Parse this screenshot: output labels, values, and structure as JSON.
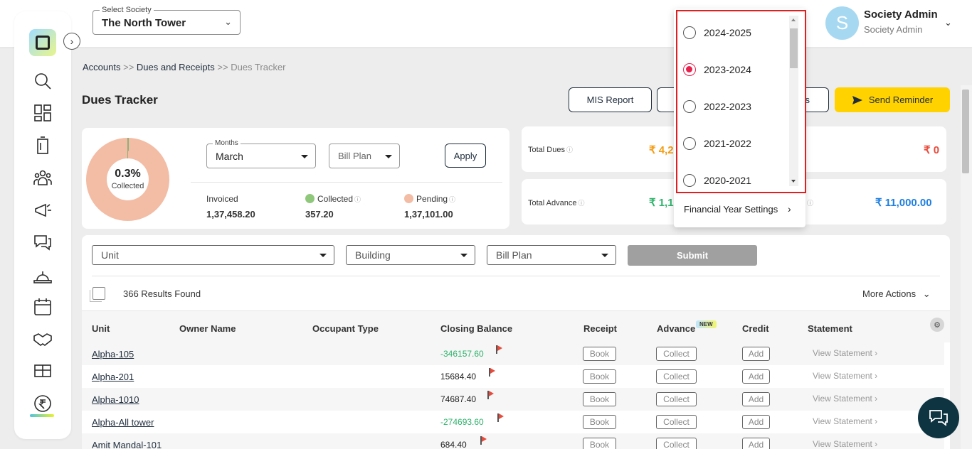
{
  "header": {
    "society_label": "Select Society",
    "society_value": "The North Tower",
    "avatar_letter": "S",
    "user_name": "Society Admin",
    "user_role": "Society Admin"
  },
  "breadcrumb": {
    "part1": "Accounts",
    "sep1": ">>",
    "part2": "Dues and Receipts",
    "sep2": ">>",
    "part3": "Dues Tracker"
  },
  "page_title": "Dues Tracker",
  "actions": {
    "mis_report": "MIS Report",
    "partial_hidden": "s",
    "send_reminder": "Send Reminder"
  },
  "summary": {
    "collected_pct": "0.3%",
    "collected_fraction": 0.003,
    "collected_label": "Collected",
    "months_label": "Months",
    "months_value": "March",
    "bill_plan_placeholder": "Bill Plan",
    "apply": "Apply",
    "invoiced_label": "Invoiced",
    "invoiced_value": "1,37,458.20",
    "collected_stat_label": "Collected",
    "collected_stat_value": "357.20",
    "pending_label": "Pending",
    "pending_value": "1,37,101.00"
  },
  "totals": {
    "total_dues_label": "Total Dues",
    "total_dues_value": "₹ 4,2",
    "right_top_value": "₹ 0",
    "total_advance_label": "Total Advance",
    "total_advance_value": "₹ 1,1",
    "right_bottom_value": "₹ 11,000.00"
  },
  "filters": {
    "unit": "Unit",
    "building": "Building",
    "bill_plan": "Bill Plan",
    "submit": "Submit",
    "results": "366 Results Found",
    "more_actions": "More Actions"
  },
  "table": {
    "headers": {
      "unit": "Unit",
      "owner": "Owner Name",
      "occupant": "Occupant Type",
      "closing": "Closing Balance",
      "receipt": "Receipt",
      "advance": "Advance",
      "new_badge": "NEW",
      "credit": "Credit",
      "statement": "Statement"
    },
    "rows": [
      {
        "unit": "Alpha-105",
        "balance": "-346157.60",
        "book": "Book",
        "collect": "Collect",
        "add": "Add",
        "statement": "View Statement"
      },
      {
        "unit": "Alpha-201",
        "balance": "15684.40",
        "book": "Book",
        "collect": "Collect",
        "add": "Add",
        "statement": "View Statement"
      },
      {
        "unit": "Alpha-1010",
        "balance": "74687.40",
        "book": "Book",
        "collect": "Collect",
        "add": "Add",
        "statement": "View Statement"
      },
      {
        "unit": "Alpha-All tower",
        "balance": "-274693.60",
        "book": "Book",
        "collect": "Collect",
        "add": "Add",
        "statement": "View Statement"
      },
      {
        "unit": "Amit Mandal-101",
        "balance": "684.40",
        "book": "Book",
        "collect": "Collect",
        "add": "Add",
        "statement": "View Statement"
      }
    ]
  },
  "dropdown": {
    "years": [
      "2024-2025",
      "2023-2024",
      "2022-2023",
      "2021-2022",
      "2020-2021"
    ],
    "selected": "2023-2024",
    "footer": "Financial Year Settings"
  },
  "colors": {
    "accent_yellow": "#ffd200",
    "positive_orange": "#f39c12",
    "negative_red": "#e84b3c",
    "advance_blue": "#1f7fe0",
    "radio_selected": "#e8204c",
    "highlight_border": "#e02020"
  }
}
